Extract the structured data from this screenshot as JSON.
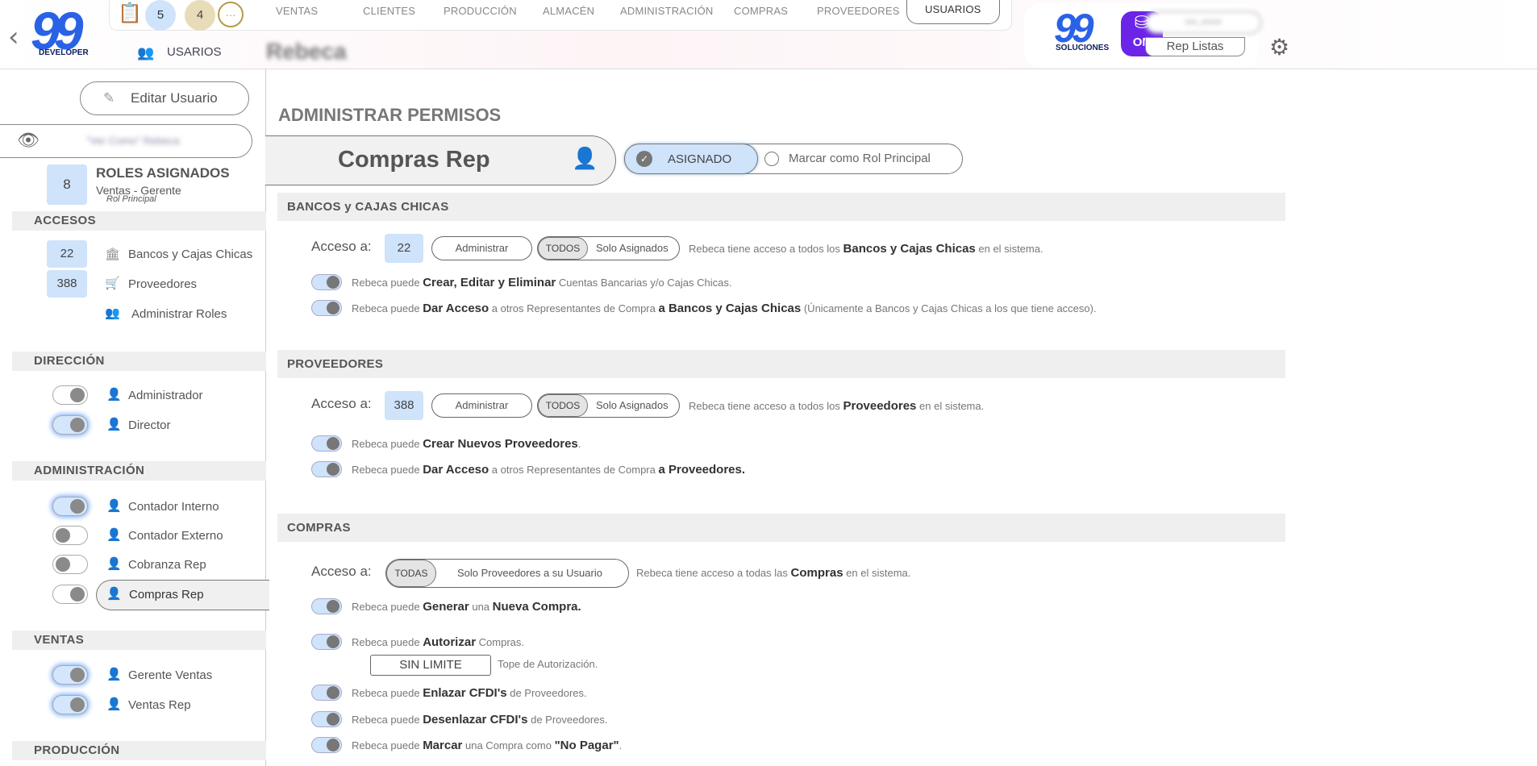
{
  "header": {
    "logo_text": "DEVELOPER",
    "badge_blue": "5",
    "badge_gold": "4",
    "nav": [
      "VENTAS",
      "CLIENTES",
      "PRODUCCIÓN",
      "ALMACÉN",
      "ADMINISTRACIÓN",
      "COMPRAS",
      "PROVEEDORES",
      "USUARIOS"
    ],
    "sub_label": "USARIOS",
    "user_name": "Rebeca",
    "right_logo_text": "SOLUCIONES",
    "on_label": "ON",
    "user_top": "xxx_xxxxx",
    "role_label": "Rep Listas"
  },
  "sidebar": {
    "edit_user": "Editar Usuario",
    "view_as": "\"Ver Como\" Rebeca",
    "roles_count": "8",
    "roles_title": "ROLES ASIGNADOS",
    "roles_main": "Ventas - Gerente",
    "roles_main_sub": "Rol Principal",
    "accesos_title": "ACCESOS",
    "accesos": [
      {
        "num": "22",
        "label": "Bancos y Cajas Chicas"
      },
      {
        "num": "388",
        "label": "Proveedores"
      },
      {
        "num": "",
        "label": "Administrar Roles"
      }
    ],
    "direccion_title": "DIRECCIÓN",
    "direccion": [
      {
        "label": "Administrador",
        "on": true
      },
      {
        "label": "Director",
        "on": true
      }
    ],
    "admin_title": "ADMINISTRACIÓN",
    "admin": [
      {
        "label": "Contador Interno",
        "on": true
      },
      {
        "label": "Contador Externo",
        "on": false
      },
      {
        "label": "Cobranza Rep",
        "on": false
      },
      {
        "label": "Compras Rep",
        "on": true
      }
    ],
    "ventas_title": "VENTAS",
    "ventas": [
      {
        "label": "Gerente Ventas",
        "on": true
      },
      {
        "label": "Ventas Rep",
        "on": true
      }
    ],
    "produccion_title": "PRODUCCIÓN"
  },
  "main": {
    "title": "ADMINISTRAR PERMISOS",
    "role_name": "Compras Rep",
    "assigned": "ASIGNADO",
    "mark_principal": "Marcar como Rol Principal",
    "acceso_label": "Acceso a:",
    "admin_btn": "Administrar",
    "todos": "TODOS",
    "solo": "Solo Asignados",
    "bancos": {
      "title": "BANCOS y CAJAS CHICAS",
      "num": "22",
      "desc": [
        "Rebeca tiene acceso a todos los ",
        "Bancos y Cajas Chicas",
        " en el sistema."
      ],
      "p1": [
        "Rebeca puede ",
        "Crear, Editar y Eliminar",
        " Cuentas Bancarias y/o Cajas Chicas."
      ],
      "p2": [
        "Rebeca puede ",
        "Dar Acceso",
        " a otros Representantes de Compra ",
        "a Bancos y Cajas Chicas",
        " (Únicamente a Bancos y Cajas Chicas a los que tiene acceso)."
      ]
    },
    "prov": {
      "title": "PROVEEDORES",
      "num": "388",
      "desc": [
        "Rebeca tiene acceso a todos los ",
        "Proveedores",
        " en el sistema."
      ],
      "p1": [
        "Rebeca puede ",
        "Crear Nuevos Proveedores",
        "."
      ],
      "p2": [
        "Rebeca puede ",
        "Dar Acceso",
        " a otros Representantes de Compra ",
        "a Proveedores."
      ]
    },
    "compras": {
      "title": "COMPRAS",
      "todas": "TODAS",
      "solo": "Solo Proveedores a su Usuario",
      "desc": [
        "Rebeca tiene acceso a todas las ",
        "Compras",
        " en el sistema."
      ],
      "p1": [
        "Rebeca puede ",
        "Generar",
        " una ",
        "Nueva Compra."
      ],
      "p2": [
        "Rebeca puede ",
        "Autorizar",
        " Compras."
      ],
      "limite": "SIN LIMITE",
      "tope": "Tope de Autorización.",
      "p3": [
        "Rebeca puede ",
        "Enlazar CFDI's",
        " de Proveedores."
      ],
      "p4": [
        "Rebeca puede ",
        "Desenlazar CFDI's",
        " de Proveedores."
      ],
      "p5": [
        "Rebeca puede ",
        "Marcar",
        " una Compra como ",
        "\"No Pagar\"",
        "."
      ]
    }
  }
}
